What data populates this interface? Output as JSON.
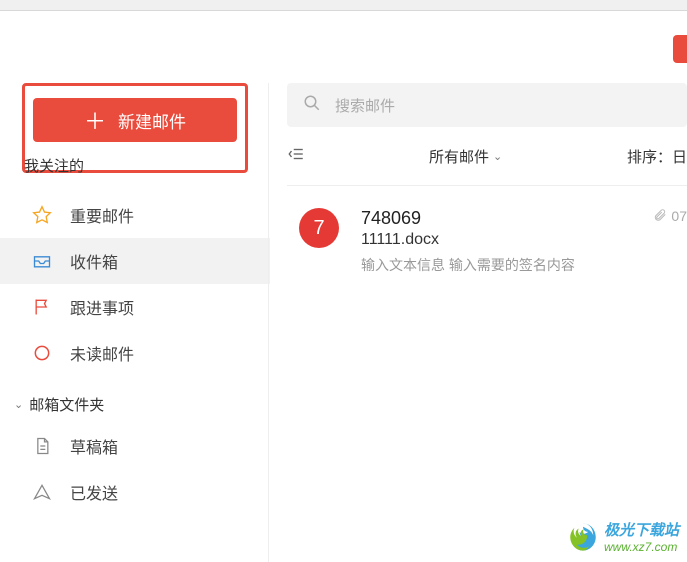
{
  "compose": {
    "label": "新建邮件"
  },
  "sidebar": {
    "section_followed": "我关注的",
    "items": [
      {
        "label": "重要邮件"
      },
      {
        "label": "收件箱"
      },
      {
        "label": "跟进事项"
      },
      {
        "label": "未读邮件"
      }
    ],
    "section_folders": "邮箱文件夹",
    "folders": [
      {
        "label": "草稿箱"
      },
      {
        "label": "已发送"
      }
    ]
  },
  "search": {
    "placeholder": "搜索邮件"
  },
  "list_header": {
    "filter": "所有邮件",
    "sort_prefix": "排序：",
    "sort_value": "日"
  },
  "emails": [
    {
      "avatar": "7",
      "sender": "748069",
      "subject": "11111.docx",
      "preview": "输入文本信息 输入需要的签名内容",
      "date": "07"
    }
  ],
  "watermark": {
    "cn": "极光下载站",
    "url": "www.xz7.com"
  }
}
